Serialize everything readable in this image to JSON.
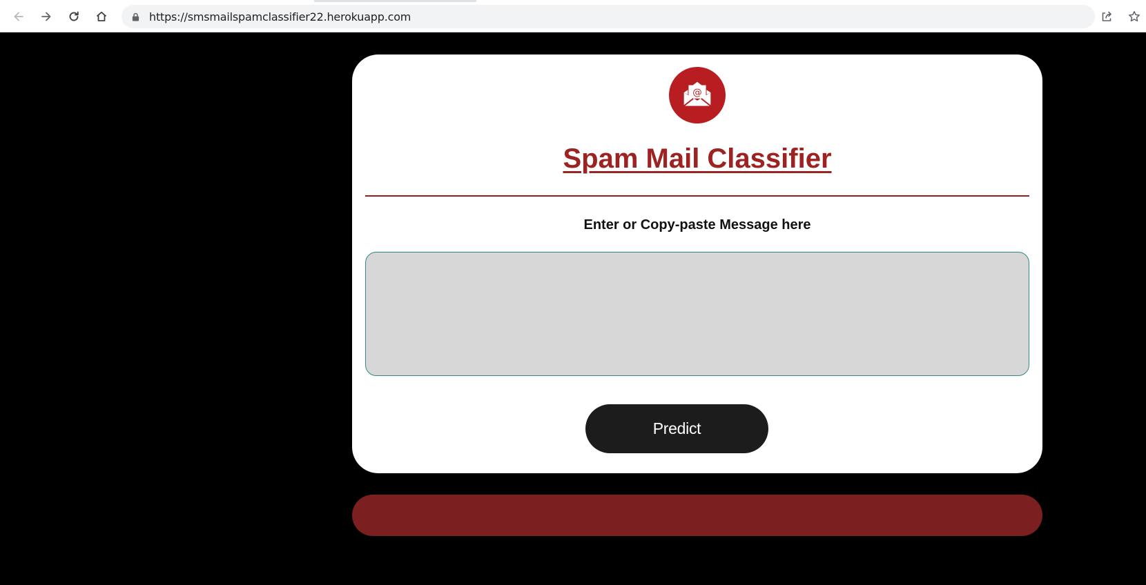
{
  "browser": {
    "url": "https://smsmailspamclassifier22.herokuapp.com",
    "icons": {
      "back": "arrow-left-icon",
      "forward": "arrow-right-icon",
      "reload": "reload-icon",
      "home": "home-icon",
      "lock": "lock-icon",
      "share": "share-icon",
      "bookmark": "star-icon"
    }
  },
  "app": {
    "logo_icon": "envelope-at-icon",
    "title": "Spam Mail Classifier",
    "subtitle": "Enter or Copy-paste Message here",
    "message_value": "",
    "predict_label": "Predict",
    "result_text": ""
  },
  "colors": {
    "page_background": "#000000",
    "accent_red": "#9d2222",
    "logo_red": "#b81d22",
    "result_bar": "#7b1f20",
    "button_dark": "#1c1c1c",
    "textarea_bg": "#d7d7d7",
    "textarea_border": "#2e8a86"
  }
}
